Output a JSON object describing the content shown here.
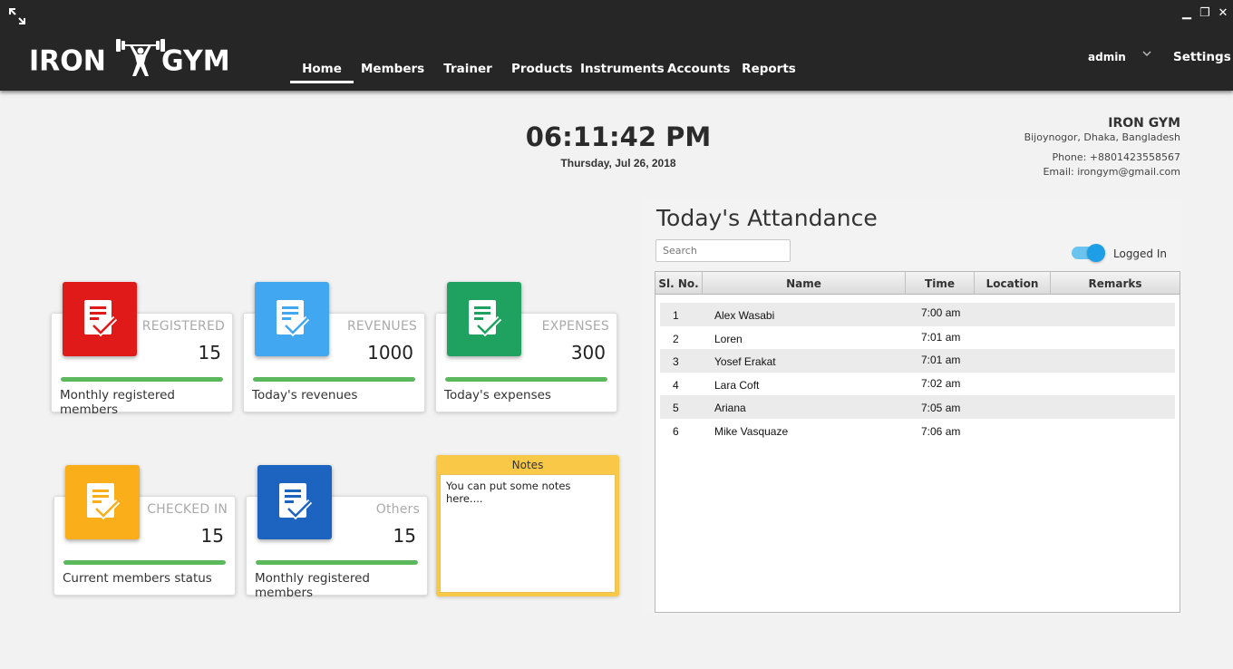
{
  "header": {
    "logo_text_left": "IRON",
    "logo_text_right": "GYM",
    "nav": [
      {
        "label": "Home",
        "active": true
      },
      {
        "label": "Members",
        "active": false
      },
      {
        "label": "Trainer",
        "active": false
      },
      {
        "label": "Products",
        "active": false
      },
      {
        "label": "Instruments",
        "active": false
      },
      {
        "label": "Accounts",
        "active": false
      },
      {
        "label": "Reports",
        "active": false
      }
    ],
    "user": "admin",
    "settings_label": "Settings",
    "window_controls": {
      "minimize": "▁",
      "restore": "❐",
      "close": "✕"
    }
  },
  "clock": {
    "time": "06:11:42 PM",
    "date": "Thursday, Jul 26, 2018"
  },
  "gym_info": {
    "name": "IRON GYM",
    "address": "Bijoynogor, Dhaka, Bangladesh",
    "phone": "Phone: +8801423558567",
    "email": "Email: irongym@gmail.com"
  },
  "cards": [
    {
      "label": "REGISTERED",
      "value": "15",
      "desc": "Monthly registered members",
      "color": "#e01919",
      "progress": 1.0
    },
    {
      "label": "REVENUES",
      "value": "1000",
      "desc": "Today's revenues",
      "color": "#41a7f1",
      "progress": 1.0
    },
    {
      "label": "EXPENSES",
      "value": "300",
      "desc": "Today's expenses",
      "color": "#1fa260",
      "progress": 1.0
    },
    {
      "label": "CHECKED IN",
      "value": "15",
      "desc": "Current members status",
      "color": "#f9ae1a",
      "progress": 1.0
    },
    {
      "label": "Others",
      "value": "15",
      "desc": "Monthly registered members",
      "color": "#1d64c0",
      "progress": 1.0
    }
  ],
  "notes": {
    "title": "Notes",
    "text": "You can put some notes here...."
  },
  "attendance": {
    "title": "Today's Attandance",
    "search_placeholder": "Search",
    "toggle_label": "Logged In",
    "toggle_on": true,
    "columns": [
      "Sl. No.",
      "Name",
      "Time",
      "Location",
      "Remarks"
    ],
    "rows": [
      {
        "sl": "1",
        "name": "Alex Wasabi",
        "time": "7:00 am"
      },
      {
        "sl": "2",
        "name": "Loren",
        "time": "7:01 am"
      },
      {
        "sl": "3",
        "name": "Yosef Erakat",
        "time": "7:01 am"
      },
      {
        "sl": "4",
        "name": "Lara Coft",
        "time": "7:02 am"
      },
      {
        "sl": "5",
        "name": "Ariana",
        "time": "7:05 am"
      },
      {
        "sl": "6",
        "name": "Mike Vasquaze",
        "time": "7:06 am"
      }
    ]
  },
  "colors": {
    "topbar": "#262626",
    "accent": "#1e9ee6",
    "progress": "#5cb85c",
    "notes": "#f9c846"
  }
}
